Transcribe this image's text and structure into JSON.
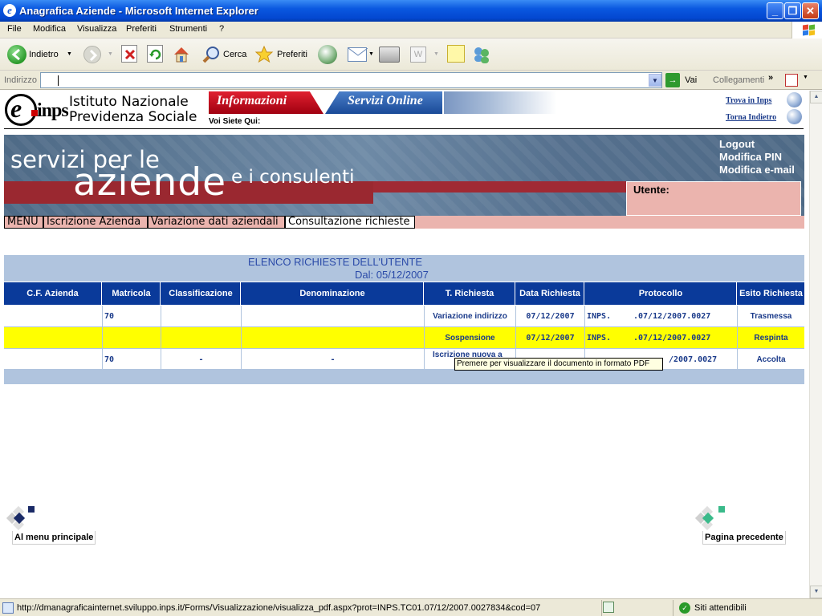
{
  "window": {
    "title": "Anagrafica Aziende - Microsoft Internet Explorer"
  },
  "menubar": {
    "items": [
      "File",
      "Modifica",
      "Visualizza",
      "Preferiti",
      "Strumenti",
      "?"
    ]
  },
  "toolbar": {
    "back": "Indietro",
    "search": "Cerca",
    "favorites": "Preferiti"
  },
  "addressbar": {
    "label": "Indirizzo",
    "value": "",
    "go": "Vai",
    "links": "Collegamenti"
  },
  "header": {
    "logo_text": "inps",
    "institute_line1": "Istituto Nazionale",
    "institute_line2": "Previdenza Sociale",
    "tab_info": "Informazioni",
    "tab_servizi": "Servizi Online",
    "voi_siete_qui": "Voi Siete Qui:",
    "trova": "Trova in Inps",
    "torna": "Torna Indietro"
  },
  "banner": {
    "servizi": "servizi per le",
    "aziende": "aziende",
    "consulenti": "e i consulenti",
    "logout": "Logout",
    "modifica_pin": "Modifica PIN",
    "modifica_email": "Modifica e-mail",
    "utente_label": "Utente:"
  },
  "tabs": [
    "MENU",
    "Iscrizione Azienda",
    "Variazione dati aziendali",
    "Consultazione richieste"
  ],
  "table": {
    "caption_line1": "ELENCO RICHIESTE DELL'UTENTE",
    "caption_line2": "Dal: 05/12/2007",
    "headers": [
      "C.F. Azienda",
      "Matricola",
      "Classificazione",
      "Denominazione",
      "T. Richiesta",
      "Data Richiesta",
      "Protocollo",
      "Esito Richiesta"
    ],
    "rows": [
      {
        "cf": "",
        "matricola": "70",
        "classificazione": "",
        "denominazione": "",
        "tipo": "Variazione indirizzo",
        "data": "07/12/2007",
        "prot_prefix": "INPS.",
        "protocollo": ".07/12/2007.0027",
        "esito": "Trasmessa"
      },
      {
        "cf": "",
        "matricola": "",
        "classificazione": "",
        "denominazione": "",
        "tipo": "Sospensione",
        "data": "07/12/2007",
        "prot_prefix": "INPS.",
        "protocollo": ".07/12/2007.0027",
        "esito": "Respinta"
      },
      {
        "cf": "",
        "matricola": "70",
        "classificazione": "-",
        "denominazione": "-",
        "tipo": "Iscrizione nuova a",
        "data": "",
        "prot_prefix": "",
        "protocollo": "/2007.0027",
        "esito": "Accolta"
      }
    ],
    "tooltip": "Premere per visualizzare il documento in formato PDF"
  },
  "bottom_nav": {
    "left": "Al menu principale",
    "right": "Pagina precedente"
  },
  "statusbar": {
    "url": "http://dmanagraficainternet.sviluppo.inps.it/Forms/Visualizzazione/visualizza_pdf.aspx?prot=INPS.TC01.07/12/2007.0027834&cod=07",
    "zone": "Siti attendibili"
  },
  "colors": {
    "header_blue": "#0a3a9a",
    "caption_bg": "#b0c4de",
    "tab_bg": "#ebb4ae",
    "highlight_row": "#ffff00",
    "link_blue": "#1a3a8a"
  }
}
